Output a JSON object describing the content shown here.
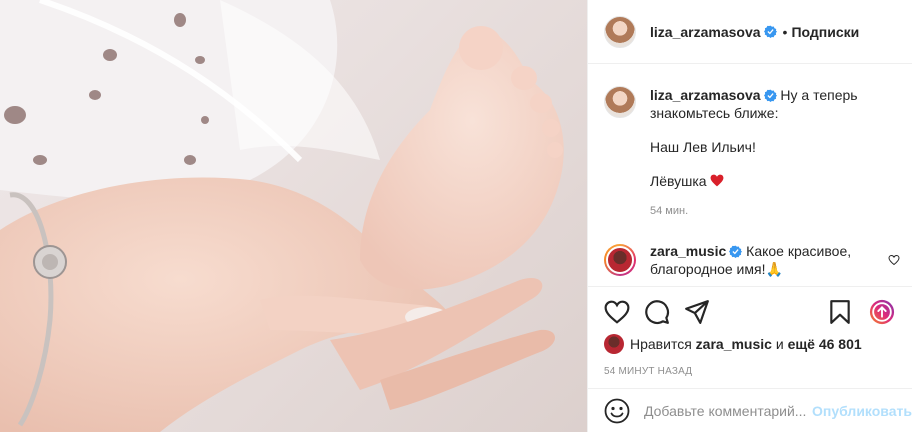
{
  "header": {
    "username": "liza_arzamasova",
    "separator": "•",
    "follow_label": "Подписки"
  },
  "caption": {
    "username": "liza_arzamasova",
    "line1": "Ну а теперь знакомьтесь ближе:",
    "line2": "Наш Лев Ильич!",
    "line3": "Лёвушка",
    "time": "54 мин."
  },
  "comment": {
    "username": "zara_music",
    "text": "Какое красивое, благородное имя!🙏"
  },
  "likes": {
    "prefix": "Нравится",
    "user": "zara_music",
    "middle": "и",
    "rest": "ещё 46 801"
  },
  "posted_ago": "54 МИНУТ НАЗАД",
  "add_comment": {
    "placeholder": "Добавьте комментарий...",
    "publish_label": "Опубликовать"
  },
  "colors": {
    "verified": "#3897f0",
    "heart": "#ed4956",
    "link_disabled": "#b2dffc"
  },
  "icons": [
    "verified-badge-icon",
    "heart-icon",
    "comment-icon",
    "share-icon",
    "bookmark-icon",
    "promote-icon",
    "emoji-icon",
    "red-heart-emoji-icon"
  ]
}
